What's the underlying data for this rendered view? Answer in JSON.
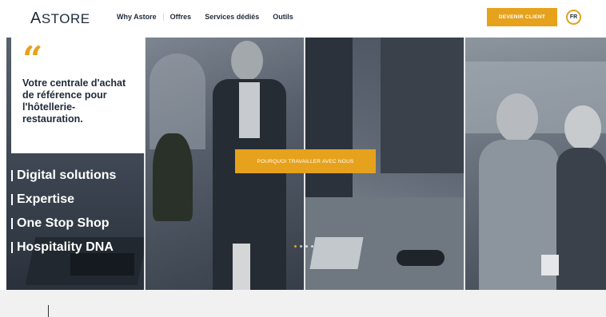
{
  "brand": {
    "logo_first": "A",
    "logo_rest": "STORE"
  },
  "nav": {
    "items": [
      {
        "label": "Why Astore"
      },
      {
        "label": "Offres"
      },
      {
        "label": "Services dédiés"
      },
      {
        "label": "Outils"
      }
    ]
  },
  "header": {
    "cta_label": "DEVENIR CLIENT",
    "language": "FR"
  },
  "hero": {
    "quote_mark": "“",
    "quote": "Votre centrale d'achat de référence pour l'hôtellerie-restauration.",
    "pillars": [
      {
        "label": "Digital solutions"
      },
      {
        "label": "Expertise"
      },
      {
        "label": "One Stop Shop"
      },
      {
        "label": "Hospitality DNA"
      }
    ],
    "cta_label": "POURQUOI TRAVAILLER AVEC NOUS",
    "carousel": {
      "slides": 4,
      "active": 1
    }
  },
  "colors": {
    "accent": "#e6a21d",
    "text": "#1f2a3a"
  }
}
